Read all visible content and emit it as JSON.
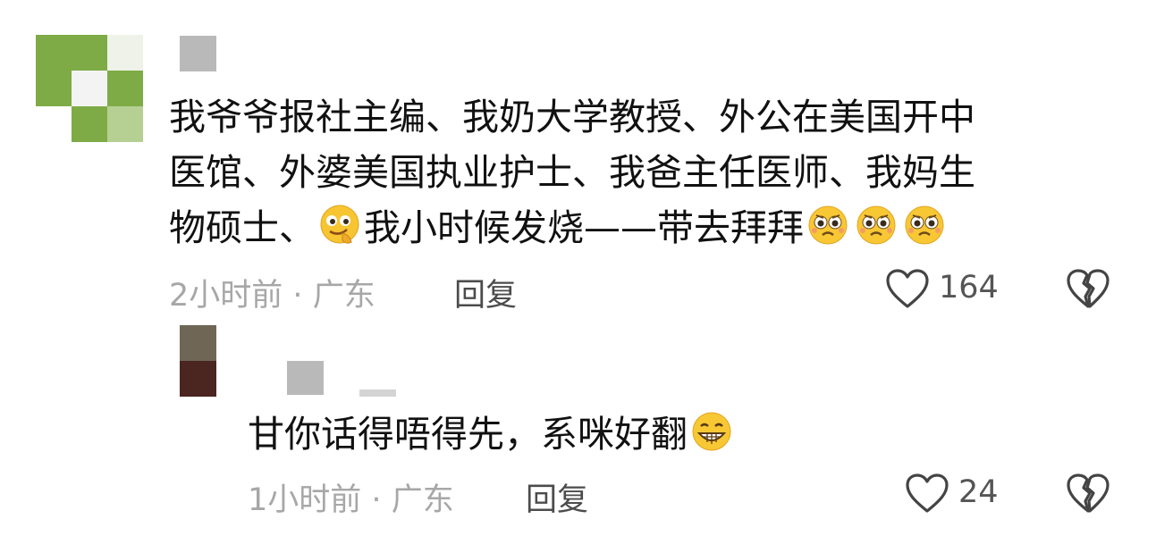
{
  "comments": [
    {
      "text_lines": [
        "我爷爷报社主编、我奶大学教授、外公在美国开中",
        "医馆、外婆美国执业护士、我爸主任医师、我妈生",
        "物硕士、"
      ],
      "text_after_emoji": "我小时候发烧——带去拜拜",
      "time": "2小时前",
      "separator": "·",
      "location": "广东",
      "reply_label": "回复",
      "likes": "164",
      "emojis": [
        "thinking-face-emoji",
        "pleading-face-emoji",
        "pleading-face-emoji",
        "pleading-face-emoji"
      ]
    },
    {
      "text": "甘你话得唔得先，系咪好翻",
      "time": "1小时前",
      "separator": "·",
      "location": "广东",
      "reply_label": "回复",
      "likes": "24",
      "emojis": [
        "grinning-face-emoji"
      ]
    }
  ],
  "colors": {
    "avatar_green": "#7eab46",
    "avatar_light": "#f0f0f0",
    "avatar_dark_top": "#6f6656",
    "avatar_dark_bottom": "#4b2520",
    "meta_gray": "#a7a7a7"
  }
}
